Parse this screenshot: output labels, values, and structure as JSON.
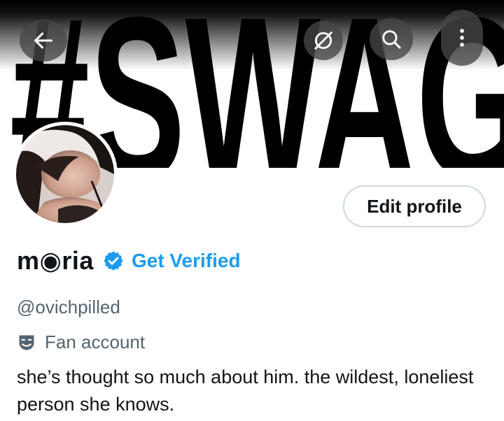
{
  "banner": {
    "text": "#SWAG"
  },
  "toolbar": {
    "back_icon": "arrow-left-icon",
    "sync_icon": "no-sync-icon",
    "search_icon": "search-icon",
    "more_icon": "vertical-dots-icon"
  },
  "profile": {
    "edit_label": "Edit profile",
    "display_name": "m◉ria",
    "get_verified_label": "Get Verified",
    "handle": "@ovichpilled",
    "category": "Fan account",
    "category_icon": "theater-masks-icon",
    "bio": "she’s thought so much about him. the wildest, loneliest person she knows."
  },
  "colors": {
    "accent": "#1d9bf0",
    "secondary_text": "#536471",
    "primary_text": "#0f1419"
  }
}
